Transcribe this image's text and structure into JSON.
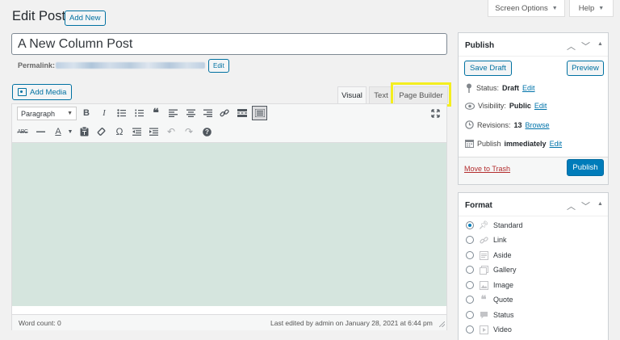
{
  "header": {
    "page_title": "Edit Post",
    "add_new_label": "Add New",
    "screen_options_label": "Screen Options",
    "help_label": "Help"
  },
  "post": {
    "title": "A New Column Post",
    "permalink_label": "Permalink:",
    "permalink_edit_label": "Edit"
  },
  "editor": {
    "add_media_label": "Add Media",
    "tabs": {
      "visual": "Visual",
      "text": "Text",
      "page_builder": "Page Builder"
    },
    "format_select_value": "Paragraph",
    "toolbar_row1": [
      "bold-icon",
      "italic-icon",
      "bulleted-list-icon",
      "numbered-list-icon",
      "blockquote-icon",
      "align-left-icon",
      "align-center-icon",
      "align-right-icon",
      "insert-link-icon",
      "read-more-icon",
      "toolbar-toggle-icon"
    ],
    "toolbar_row2": [
      "strikethrough-icon",
      "horizontal-line-icon",
      "text-color-icon",
      "paste-as-text-icon",
      "clear-formatting-icon",
      "special-character-icon",
      "decrease-indent-icon",
      "increase-indent-icon",
      "undo-icon",
      "redo-icon",
      "keyboard-shortcuts-icon"
    ],
    "word_count": "Word count: 0",
    "last_edited": "Last edited by admin on January 28, 2021 at 6:44 pm"
  },
  "publish": {
    "title": "Publish",
    "save_draft_label": "Save Draft",
    "preview_label": "Preview",
    "status_label": "Status:",
    "status_value": "Draft",
    "status_edit": "Edit",
    "visibility_label": "Visibility:",
    "visibility_value": "Public",
    "visibility_edit": "Edit",
    "revisions_label": "Revisions:",
    "revisions_value": "13",
    "revisions_browse": "Browse",
    "publish_label": "Publish",
    "publish_value": "immediately",
    "publish_edit": "Edit",
    "trash_label": "Move to Trash",
    "publish_button_label": "Publish"
  },
  "format": {
    "title": "Format",
    "options": [
      {
        "label": "Standard",
        "icon": "pin-icon",
        "checked": true
      },
      {
        "label": "Link",
        "icon": "link-icon",
        "checked": false
      },
      {
        "label": "Aside",
        "icon": "aside-icon",
        "checked": false
      },
      {
        "label": "Gallery",
        "icon": "gallery-icon",
        "checked": false
      },
      {
        "label": "Image",
        "icon": "image-icon",
        "checked": false
      },
      {
        "label": "Quote",
        "icon": "quote-icon",
        "checked": false
      },
      {
        "label": "Status",
        "icon": "status-icon",
        "checked": false
      },
      {
        "label": "Video",
        "icon": "video-icon",
        "checked": false
      }
    ]
  },
  "colors": {
    "accent": "#0071a1",
    "primary_button": "#007cba",
    "trash_link": "#b32d2e",
    "highlight": "#f4ee1f",
    "editor_content": "#d5e5de"
  }
}
